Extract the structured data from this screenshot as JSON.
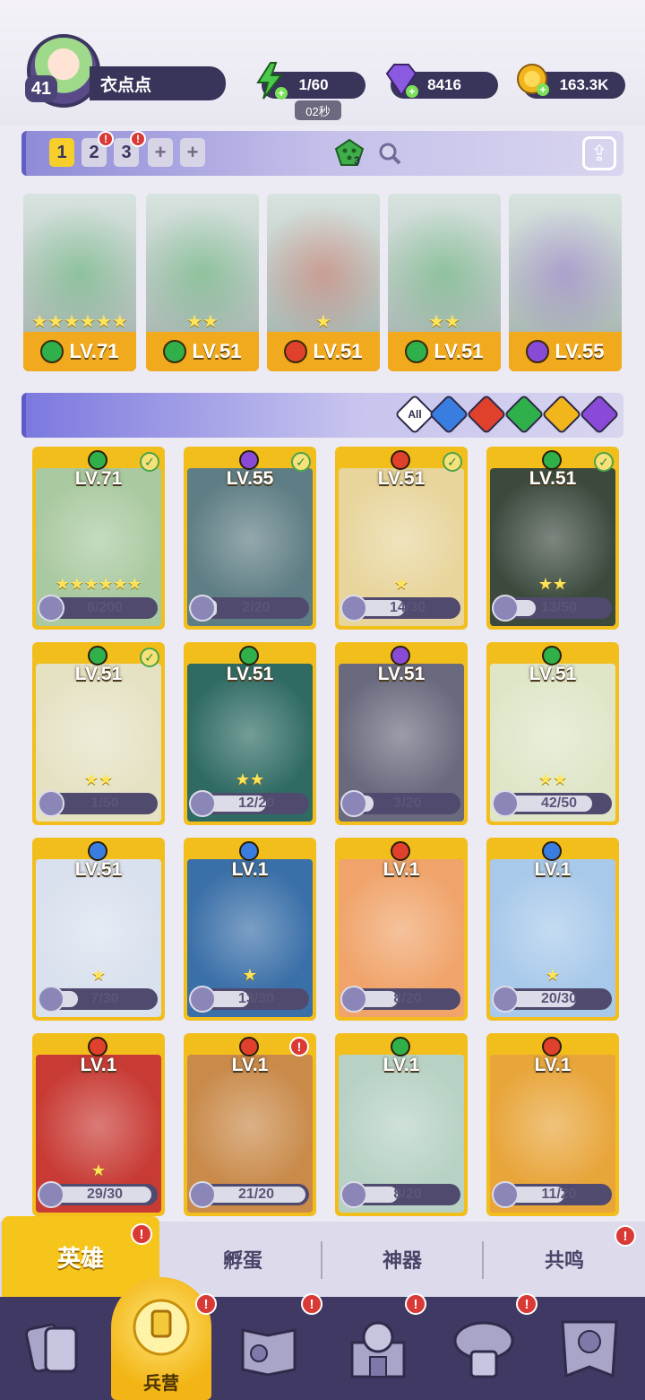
{
  "player": {
    "level": "41",
    "name": "衣点点"
  },
  "resources": {
    "energy": {
      "value": "1/60",
      "icon": "lightning-icon",
      "color": "#4ac94a"
    },
    "gems": {
      "value": "8416",
      "icon": "diamond-icon",
      "color": "#8a5ae0"
    },
    "gold": {
      "value": "163.3K",
      "icon": "coin-icon",
      "color": "#f2b51c"
    },
    "energy_timer": "02秒"
  },
  "team_tabs": [
    {
      "label": "1",
      "state": "active"
    },
    {
      "label": "2",
      "state": "inactive",
      "alert": "!"
    },
    {
      "label": "3",
      "state": "inactive",
      "alert": "!"
    },
    {
      "label": "+",
      "state": "add"
    },
    {
      "label": "+",
      "state": "add"
    }
  ],
  "team_dice_count": "3",
  "team": [
    {
      "level": "LV.71",
      "element": "green",
      "stars": "★★★★★★"
    },
    {
      "level": "LV.51",
      "element": "green",
      "stars": "★★"
    },
    {
      "level": "LV.51",
      "element": "red",
      "stars": "★"
    },
    {
      "level": "LV.51",
      "element": "green",
      "stars": "★★"
    },
    {
      "level": "LV.55",
      "element": "purple",
      "stars": ""
    }
  ],
  "filters": [
    {
      "label": "All",
      "color": "#ffffff",
      "icon": "all-filter-icon"
    },
    {
      "label": "",
      "color": "#3a7de0",
      "icon": "water-element-icon"
    },
    {
      "label": "",
      "color": "#e0412d",
      "icon": "fire-element-icon"
    },
    {
      "label": "",
      "color": "#2fb04a",
      "icon": "wind-element-icon"
    },
    {
      "label": "",
      "color": "#f2b51c",
      "icon": "light-element-icon"
    },
    {
      "label": "",
      "color": "#8a4ad8",
      "icon": "dark-element-icon"
    }
  ],
  "element_colors": {
    "green": "#2fb04a",
    "red": "#e0412d",
    "blue": "#3a7de0",
    "purple": "#8a4ad8"
  },
  "heroes": [
    {
      "level": "LV.71",
      "element": "green",
      "progress": "6/200",
      "fraction": 0.03,
      "checked": true,
      "stars": "★★★★★★",
      "bg": "#a9c9a0"
    },
    {
      "level": "LV.55",
      "element": "purple",
      "progress": "2/20",
      "fraction": 0.1,
      "checked": true,
      "stars": "",
      "bg": "#5e7d84"
    },
    {
      "level": "LV.51",
      "element": "red",
      "progress": "14/30",
      "fraction": 0.47,
      "checked": true,
      "stars": "★",
      "bg": "#e8d59c"
    },
    {
      "level": "LV.51",
      "element": "green",
      "progress": "13/50",
      "fraction": 0.26,
      "checked": true,
      "stars": "★★",
      "bg": "#3c4a3e"
    },
    {
      "level": "LV.51",
      "element": "green",
      "progress": "1/50",
      "fraction": 0.02,
      "checked": true,
      "stars": "★★",
      "bg": "#e5e2c4"
    },
    {
      "level": "LV.51",
      "element": "green",
      "progress": "12/20",
      "fraction": 0.6,
      "checked": false,
      "stars": "★★",
      "bg": "#2f6b63"
    },
    {
      "level": "LV.51",
      "element": "purple",
      "progress": "3/20",
      "fraction": 0.15,
      "checked": false,
      "stars": "",
      "bg": "#6a6a7e"
    },
    {
      "level": "LV.51",
      "element": "green",
      "progress": "42/50",
      "fraction": 0.84,
      "checked": false,
      "stars": "★★",
      "bg": "#dfe6c8"
    },
    {
      "level": "LV.51",
      "element": "blue",
      "progress": "7/30",
      "fraction": 0.23,
      "checked": false,
      "stars": "★",
      "bg": "#d9e1ee"
    },
    {
      "level": "LV.1",
      "element": "blue",
      "progress": "13/30",
      "fraction": 0.43,
      "checked": false,
      "stars": "★",
      "bg": "#3a6fa8"
    },
    {
      "level": "LV.1",
      "element": "red",
      "progress": "8/20",
      "fraction": 0.4,
      "checked": false,
      "stars": "",
      "bg": "#f0a46b"
    },
    {
      "level": "LV.1",
      "element": "blue",
      "progress": "20/30",
      "fraction": 0.67,
      "checked": false,
      "stars": "★",
      "bg": "#a8c9ea"
    },
    {
      "level": "LV.1",
      "element": "red",
      "progress": "29/30",
      "fraction": 0.97,
      "checked": false,
      "stars": "★",
      "bg": "#c83a34"
    },
    {
      "level": "LV.1",
      "element": "red",
      "progress": "21/20",
      "fraction": 1.0,
      "checked": false,
      "alert": "!",
      "stars": "",
      "bg": "#c98a4a"
    },
    {
      "level": "LV.1",
      "element": "green",
      "progress": "8/20",
      "fraction": 0.4,
      "checked": false,
      "stars": "",
      "bg": "#b7d2c4"
    },
    {
      "level": "LV.1",
      "element": "red",
      "progress": "11/20",
      "fraction": 0.55,
      "checked": false,
      "stars": "",
      "bg": "#e8a53a"
    }
  ],
  "subtabs": [
    {
      "label": "英雄",
      "active": true,
      "alert": "!"
    },
    {
      "label": "孵蛋",
      "active": false
    },
    {
      "label": "神器",
      "active": false
    },
    {
      "label": "共鸣",
      "active": false,
      "alert": "!"
    }
  ],
  "nav": [
    {
      "label": "",
      "icon": "cards-icon",
      "active": false
    },
    {
      "label": "兵营",
      "icon": "barracks-icon",
      "active": true,
      "alert": "!"
    },
    {
      "label": "",
      "icon": "map-book-icon",
      "active": false,
      "alert": "!"
    },
    {
      "label": "",
      "icon": "castle-icon",
      "active": false,
      "alert": "!"
    },
    {
      "label": "",
      "icon": "guild-icon",
      "active": false,
      "alert": "!"
    },
    {
      "label": "",
      "icon": "banner-icon",
      "active": false
    }
  ]
}
